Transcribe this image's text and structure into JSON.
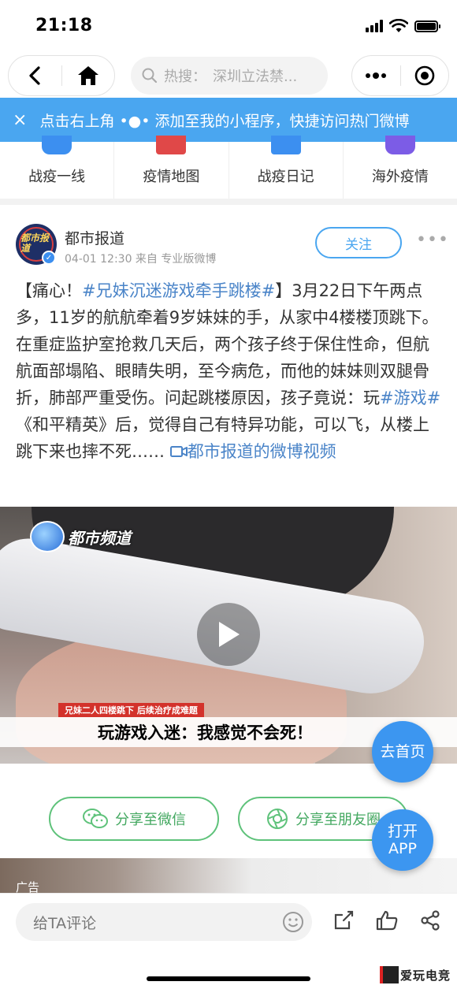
{
  "status_bar": {
    "time": "21:18"
  },
  "nav": {
    "search_prefix": "热搜：",
    "search_text": "深圳立法禁..."
  },
  "banner": {
    "close": "×",
    "text": "点击右上角 •●• 添加至我的小程序，快捷访问热门微博"
  },
  "quick_links": [
    {
      "label": "战疫一线",
      "color": "#3c8ff0"
    },
    {
      "label": "疫情地图",
      "color": "#e04848"
    },
    {
      "label": "战疫日记",
      "color": "#3c8ff0"
    },
    {
      "label": "海外疫情",
      "color": "#7c5ce6"
    }
  ],
  "post": {
    "author": "都市报道",
    "avatar_text": "都市报道",
    "meta": "04-01 12:30 来自 专业版微博",
    "follow": "关注",
    "more": "•••",
    "body_1": "【痛心！",
    "hashtag_1": "#兄妹沉迷游戏牵手跳楼#",
    "body_2": "】3月22日下午两点多，11岁的航航牵着9岁妹妹的手，从家中4楼楼顶跳下。在重症监护室抢救几天后，两个孩子终于保住性命，但航航面部塌陷、眼睛失明，至今病危，而他的妹妹则双腿骨折，肺部严重受伤。问起跳楼原因，孩子竟说：玩",
    "hashtag_2": "#游戏#",
    "body_3": "《和平精英》后，觉得自己有特异功能，可以飞，从楼上跳下来也摔不死……",
    "video_link": "都市报道的微博视频"
  },
  "video": {
    "channel": "都市频道",
    "caption_small": "兄妹二人四楼跳下  后续治疗成难题",
    "caption_main": "玩游戏入迷：我感觉不会死！"
  },
  "share": {
    "wechat": "分享至微信",
    "moments": "分享至朋友圈"
  },
  "ad": {
    "label": "广告"
  },
  "fab": {
    "home": "去首页",
    "open_app_line1": "打开",
    "open_app_line2": "APP"
  },
  "bottom": {
    "comment_placeholder": "给TA评论"
  },
  "watermark": {
    "text": "爱玩电竞"
  },
  "colors": {
    "accent": "#4aa6f0",
    "link": "#4a84c8",
    "share_green": "#5ec27a"
  }
}
